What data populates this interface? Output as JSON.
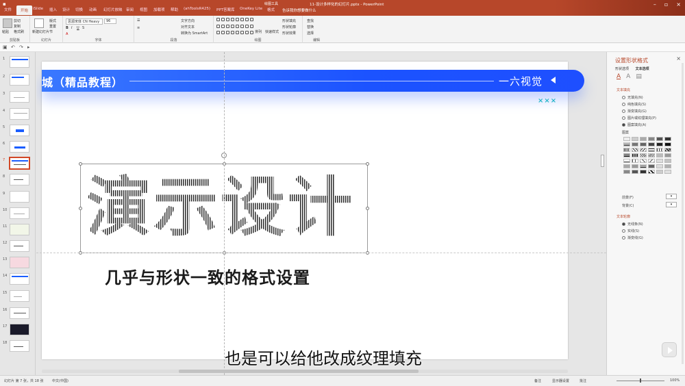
{
  "titlebar": {
    "doc_title": "11-设计多样化的幻灯片.pptx - PowerPoint",
    "drawing_tools": "绘图工具",
    "tell_me": "告诉我你想要做什么",
    "tabs": [
      "文件",
      "开始",
      "iSlide",
      "插入",
      "设计",
      "切换",
      "动画",
      "幻灯片放映",
      "审阅",
      "视图",
      "加载项",
      "帮助",
      "OneKey Lite",
      "格式"
    ],
    "tabs_extra": [
      "(ahToolsR425)",
      "PPT答案库",
      "iSlide",
      "OneKey Lite",
      "格式"
    ],
    "active_tab": "开始"
  },
  "ribbon": {
    "clipboard": {
      "paste": "粘贴",
      "cut": "剪切",
      "copy": "复制",
      "format_painter": "格式刷",
      "label": "剪贴板"
    },
    "slides": {
      "new_slide": "新建幻灯片",
      "layout": "版式",
      "reset": "重置",
      "section": "节",
      "label": "幻灯片"
    },
    "font": {
      "name": "思源宋体 CN Heavy",
      "size": "96",
      "label": "字体"
    },
    "paragraph": {
      "text_direction": "文字方向",
      "align_text": "对齐文本",
      "smartart": "转换为 SmartArt",
      "label": "段落"
    },
    "drawing": {
      "arrange": "排列",
      "quick_styles": "快速样式",
      "fill": "形状填充",
      "outline": "形状轮廓",
      "effects": "形状效果",
      "label": "绘图"
    },
    "editing": {
      "find": "查找",
      "replace": "替换",
      "select": "选择",
      "label": "编辑"
    }
  },
  "thumbnails": [
    {
      "num": "1"
    },
    {
      "num": "2"
    },
    {
      "num": "3"
    },
    {
      "num": "4"
    },
    {
      "num": "5"
    },
    {
      "num": "6"
    },
    {
      "num": "7",
      "active": true
    },
    {
      "num": "8"
    },
    {
      "num": "9"
    },
    {
      "num": "10"
    },
    {
      "num": "11"
    },
    {
      "num": "12"
    },
    {
      "num": "13"
    },
    {
      "num": "14"
    },
    {
      "num": "15"
    },
    {
      "num": "16"
    },
    {
      "num": "17"
    },
    {
      "num": "18"
    }
  ],
  "slide": {
    "banner_title": "城（精品教程）",
    "banner_right": "一六视觉",
    "marks": "×××",
    "big_text": "演示设计",
    "subtitle": "几乎与形状一致的格式设置",
    "banner_color": "#1e55ff",
    "mark_color": "#27b6c9"
  },
  "caption": "也是可以给他改成纹理填充",
  "pane": {
    "title": "设置形状格式",
    "tabs": [
      "形状选项",
      "文本选项"
    ],
    "text_fill_section": "文本填充",
    "fill_options": [
      "无填充(N)",
      "纯色填充(S)",
      "渐变填充(G)",
      "图片或纹理填充(P)",
      "图案填充(A)"
    ],
    "selected_fill": 4,
    "pattern_label": "图案",
    "foreground": "前景(F)",
    "background": "背景(C)",
    "outline_section": "文本轮廓",
    "outline_options": [
      "无线条(N)",
      "实线(S)",
      "渐变线(G)"
    ],
    "selected_outline": 0
  },
  "status": {
    "slide_info": "幻灯片 第 7 张，共 18 张",
    "language": "中文(中国)",
    "notes": "备注",
    "display": "显示器设置",
    "comments": "批注",
    "zoom": "100%"
  }
}
